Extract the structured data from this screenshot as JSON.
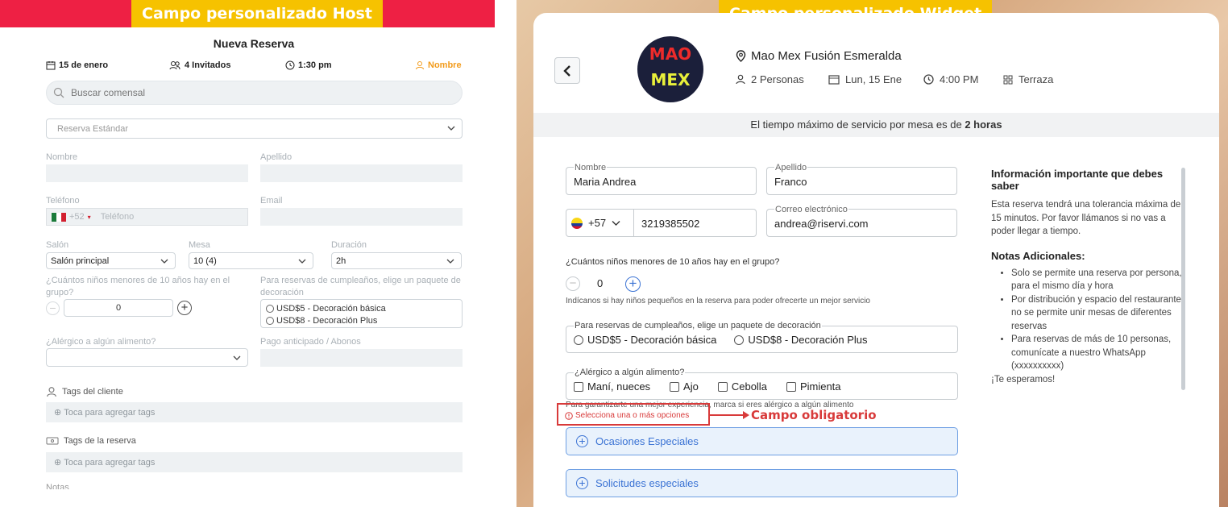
{
  "host": {
    "banner": "Campo personalizado Host",
    "title": "Nueva Reserva",
    "date": "15 de enero",
    "guests": "4 Invitados",
    "time": "1:30 pm",
    "name_link": "Nombre",
    "search_placeholder": "Buscar comensal",
    "reservation_type": "Reserva Estándar",
    "labels": {
      "nombre": "Nombre",
      "apellido": "Apellido",
      "telefono": "Teléfono",
      "email": "Email",
      "salon": "Salón",
      "mesa": "Mesa",
      "duracion": "Duración",
      "ninos": "¿Cuántos niños menores de 10 años hay en el grupo?",
      "cumple": "Para reservas de cumpleaños, elige un paquete de decoración",
      "alergico": "¿Alérgico a algún alimento?",
      "pago": "Pago anticipado / Abonos",
      "tags_cliente": "Tags del cliente",
      "tags_reserva": "Tags de la reserva",
      "notas": "Notas"
    },
    "phone_code": "+52",
    "phone_placeholder": "Teléfono",
    "salon_value": "Salón principal",
    "mesa_value": "10 (4)",
    "duracion_value": "2h",
    "ninos_value": "0",
    "deco_options": [
      "USD$5 - Decoración básica",
      "USD$8 - Decoración Plus"
    ],
    "tag_prompt": "Toca para agregar tags"
  },
  "widget": {
    "banner": "Campo personalizado Widget",
    "logo_top": "MAO",
    "logo_bottom": "MEX",
    "restaurant": "Mao Mex Fusión Esmeralda",
    "people": "2 Personas",
    "date": "Lun, 15 Ene",
    "time": "4:00 PM",
    "area": "Terraza",
    "notice_prefix": "El tiempo máximo de servicio por mesa es de",
    "notice_bold": "2 horas",
    "nombre_label": "Nombre",
    "nombre_value": "Maria Andrea",
    "apellido_label": "Apellido",
    "apellido_value": "Franco",
    "phone_code": "+57",
    "phone_value": "3219385502",
    "email_label": "Correo electrónico",
    "email_value": "andrea@riservi.com",
    "ninos_question": "¿Cuántos niños menores de 10 años hay en el grupo?",
    "ninos_value": "0",
    "ninos_hint": "Indícanos si hay niños pequeños en la reserva para poder ofrecerte un mejor servicio",
    "cumple_label": "Para reservas de cumpleaños, elige un paquete de decoración",
    "deco_options": [
      "USD$5 - Decoración básica",
      "USD$8 - Decoración Plus"
    ],
    "alergico_label": "¿Alérgico a algún alimento?",
    "alergico_options": [
      "Maní, nueces",
      "Ajo",
      "Cebolla",
      "Pimienta"
    ],
    "alergico_hint": "Para garantizarte una mejor experiencia, marca si eres alérgico a algún alimento",
    "error": "Selecciona una o más opciones",
    "callout": "Campo obligatorio",
    "accordions": [
      "Ocasiones Especiales",
      "Solicitudes especiales"
    ],
    "side_title": "Información importante que debes saber",
    "side_text": "Esta reserva tendrá una tolerancia máxima de 15 minutos. Por favor llámanos si no vas a poder llegar a tiempo.",
    "side_notes_title": "Notas Adicionales:",
    "side_notes": [
      "Solo se permite una reserva por persona, para el mismo día y hora",
      "Por distribución y espacio del restaurante no se permite unir mesas de diferentes reservas",
      "Para reservas de más de 10 personas, comunícate a nuestro WhatsApp (xxxxxxxxxx)"
    ],
    "side_bye": "¡Te esperamos!"
  },
  "colors": {
    "host_red": "#ee2044",
    "banner_yellow": "#f6c200",
    "accent_orange": "#f29b1b",
    "error_red": "#d83a3a",
    "link_blue": "#3b73d4"
  }
}
